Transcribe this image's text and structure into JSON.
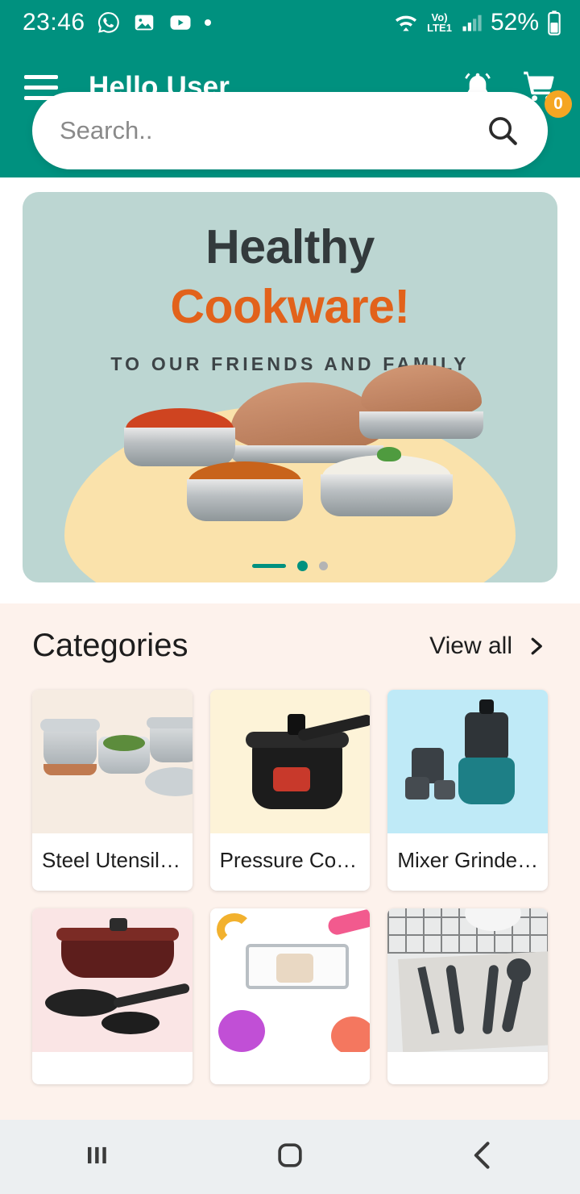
{
  "status_bar": {
    "clock": "23:46",
    "icons": [
      "whatsapp-icon",
      "gallery-icon",
      "youtube-icon",
      "dot-icon"
    ],
    "network_label_top": "Vo)",
    "network_label_bottom": "LTE1",
    "battery_percent": "52%"
  },
  "app_bar": {
    "menu_icon": "hamburger-menu-icon",
    "title": "Hello User",
    "notification_icon": "bell-icon",
    "cart_icon": "cart-icon",
    "cart_count": "0"
  },
  "search": {
    "placeholder": "Search..",
    "value": "",
    "icon": "search-icon"
  },
  "banner": {
    "headline": "Healthy",
    "headline_accent": "Cookware!",
    "subtitle": "TO OUR FRIENDS AND FAMILY",
    "slide_indicator_active": 1,
    "slide_count": 2,
    "accent_color": "#e2621b",
    "background_color": "#bcd6d2"
  },
  "categories": {
    "title": "Categories",
    "view_all_label": "View all",
    "view_all_icon": "chevron-right-icon",
    "items": [
      {
        "label": "Steel Utensils...",
        "art": "c1"
      },
      {
        "label": "Pressure Coo...",
        "art": "c2"
      },
      {
        "label": "Mixer Grinder(...",
        "art": "c3"
      },
      {
        "label": "",
        "art": "c4"
      },
      {
        "label": "",
        "art": "c5"
      },
      {
        "label": "",
        "art": "c6"
      }
    ]
  },
  "nav_bar": {
    "recents_icon": "recents-icon",
    "home_icon": "home-icon",
    "back_icon": "back-icon"
  },
  "colors": {
    "primary": "#00917f",
    "badge": "#f5a623",
    "page_bg": "#fdf2ec"
  }
}
